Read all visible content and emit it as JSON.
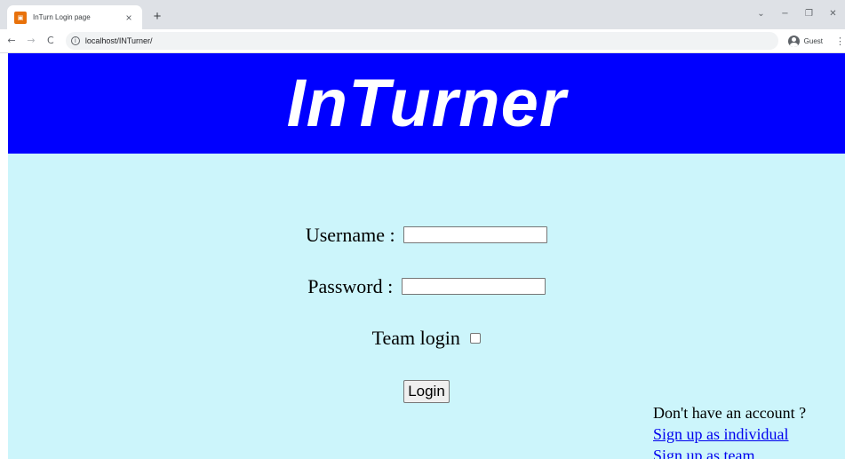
{
  "browser": {
    "tab_title": "InTurn Login page",
    "tab_close": "×",
    "new_tab": "+",
    "url": "localhost/INTurner/",
    "profile_label": "Guest",
    "window_controls": {
      "dropdown": "⌄",
      "minimize": "−",
      "restore": "❐",
      "close": "✕"
    },
    "nav": {
      "back": "←",
      "forward": "→",
      "reload": "C"
    },
    "icons": [
      "favicon",
      "back-icon",
      "forward-icon",
      "reload-icon",
      "info-icon",
      "profile-icon",
      "menu-icon"
    ]
  },
  "page": {
    "banner_title": "InTurner",
    "banner_color": "#0000ff",
    "background_color": "#ccf5fb",
    "username_label": "Username :",
    "username_value": "",
    "password_label": "Password :",
    "password_value": "",
    "team_login_label": "Team login",
    "team_login_checked": false,
    "login_button": "Login",
    "signup_question": "Don't have an account ?",
    "signup_individual": "Sign up as individual",
    "signup_team": "Sign up as team",
    "link_color": "#0000ee"
  }
}
